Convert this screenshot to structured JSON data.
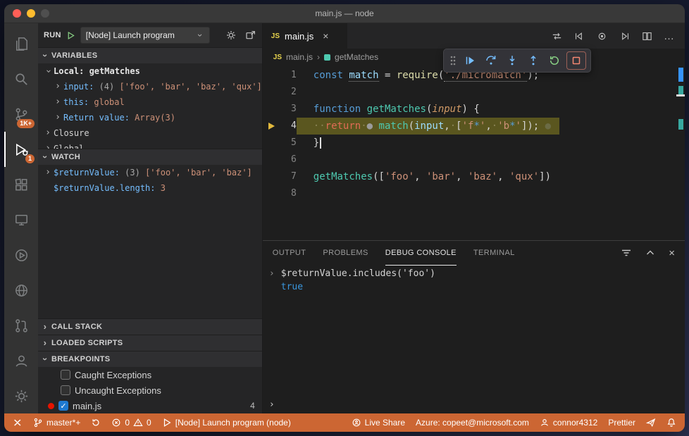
{
  "window": {
    "title": "main.js — node"
  },
  "icons": {
    "chevron": "›",
    "close": "×",
    "js": "JS",
    "sep": "›",
    "more": "…",
    "prompt": "›",
    "check": "✓"
  },
  "colors": {
    "status_bar": "#CC6633",
    "badge": "#CC6633",
    "accent": "#75BEFF",
    "debug_green": "#89D185",
    "debug_red": "#F48771",
    "current_line": "#5A561F",
    "breakpoint_red": "#E51400",
    "keyword": "#569CD6",
    "function": "#DCDCAA",
    "type_green": "#4EC9B0",
    "variable": "#9CDCFE",
    "string": "#CE9178",
    "control": "#E06C55",
    "param": "#D19A66",
    "console_blue": "#3A96DD",
    "checkbox_blue": "#1F7AD1",
    "debug_arrow": "#E2B93D",
    "traffic_red": "#FF5F57",
    "traffic_yellow": "#FEBC2E",
    "traffic_gray": "#4F4F4F"
  },
  "activity_bar": {
    "scm_badge": "1K+",
    "debug_badge": "1"
  },
  "sidebar": {
    "run": {
      "label": "RUN",
      "config": "[Node] Launch program"
    },
    "variables": {
      "title": "VARIABLES",
      "rows": [
        {
          "indent": 1,
          "chev": "open",
          "tokens": [
            {
              "t": "Local: getMatches",
              "c": "scope"
            }
          ]
        },
        {
          "indent": 2,
          "chev": "closed",
          "tokens": [
            {
              "t": "input: ",
              "c": "vname"
            },
            {
              "t": "(4) ",
              "c": "vmeta"
            },
            {
              "t": "['foo', 'bar', 'baz', 'qux']",
              "c": "vstr"
            }
          ]
        },
        {
          "indent": 2,
          "chev": "closed",
          "tokens": [
            {
              "t": "this: ",
              "c": "vname"
            },
            {
              "t": "global",
              "c": "vval"
            }
          ]
        },
        {
          "indent": 2,
          "chev": "closed",
          "tokens": [
            {
              "t": "Return value: ",
              "c": "vname"
            },
            {
              "t": "Array(3)",
              "c": "vval"
            }
          ]
        },
        {
          "indent": 1,
          "chev": "closed",
          "tokens": [
            {
              "t": "Closure",
              "c": "vplain"
            }
          ]
        },
        {
          "indent": 1,
          "chev": "closed",
          "tokens": [
            {
              "t": "Global",
              "c": "vplain"
            }
          ]
        }
      ]
    },
    "watch": {
      "title": "WATCH",
      "rows": [
        {
          "indent": 1,
          "chev": "closed",
          "tokens": [
            {
              "t": "$returnValue: ",
              "c": "vname"
            },
            {
              "t": "(3) ",
              "c": "vmeta"
            },
            {
              "t": "['foo', 'bar', 'baz']",
              "c": "vstr"
            }
          ]
        },
        {
          "indent": 1,
          "chev": "none",
          "tokens": [
            {
              "t": "$returnValue.length: ",
              "c": "vname"
            },
            {
              "t": "3",
              "c": "vstr"
            }
          ]
        }
      ]
    },
    "call_stack": {
      "title": "CALL STACK"
    },
    "loaded_scripts": {
      "title": "LOADED SCRIPTS"
    },
    "breakpoints": {
      "title": "BREAKPOINTS",
      "items": [
        {
          "checked": false,
          "dot": false,
          "label": "Caught Exceptions"
        },
        {
          "checked": false,
          "dot": false,
          "label": "Uncaught Exceptions"
        },
        {
          "checked": true,
          "dot": true,
          "label": "main.js",
          "right": "4"
        }
      ]
    }
  },
  "editor": {
    "tab": {
      "label": "main.js"
    },
    "breadcrumb": {
      "file": "main.js",
      "symbol": "getMatches"
    },
    "lines": [
      {
        "n": "1",
        "tokens": [
          {
            "t": "const",
            "c": "kw"
          },
          {
            "t": " "
          },
          {
            "t": "match",
            "c": "var u"
          },
          {
            "t": " = ",
            "c": "pun"
          },
          {
            "t": "require",
            "c": "fn"
          },
          {
            "t": "(",
            "c": "pun"
          },
          {
            "t": "'./micromatch'",
            "c": "str u"
          },
          {
            "t": ");",
            "c": "pun"
          }
        ]
      },
      {
        "n": "2",
        "tokens": []
      },
      {
        "n": "3",
        "tokens": [
          {
            "t": "function",
            "c": "kw"
          },
          {
            "t": " "
          },
          {
            "t": "getMatches",
            "c": "fng"
          },
          {
            "t": "(",
            "c": "pun"
          },
          {
            "t": "input",
            "c": "param"
          },
          {
            "t": ") {",
            "c": "pun"
          }
        ]
      },
      {
        "n": "4",
        "current": true,
        "tokens": [
          {
            "t": "··",
            "c": "ws"
          },
          {
            "t": "return",
            "c": "ctrl"
          },
          {
            "t": "·",
            "c": "ws"
          },
          {
            "t": "●",
            "c": "dot"
          },
          {
            "t": " "
          },
          {
            "t": "match",
            "c": "fng"
          },
          {
            "t": "(",
            "c": "pun"
          },
          {
            "t": "input",
            "c": "var"
          },
          {
            "t": ",",
            "c": "pun"
          },
          {
            "t": "·",
            "c": "ws"
          },
          {
            "t": "[",
            "c": "pun"
          },
          {
            "t": "'f",
            "c": "str"
          },
          {
            "t": "*",
            "c": "kw"
          },
          {
            "t": "'",
            "c": "str"
          },
          {
            "t": ",",
            "c": "pun"
          },
          {
            "t": "·",
            "c": "ws"
          },
          {
            "t": "'b",
            "c": "str"
          },
          {
            "t": "*",
            "c": "kw"
          },
          {
            "t": "'",
            "c": "str"
          },
          {
            "t": "]);",
            "c": "pun"
          },
          {
            "t": " ●",
            "c": "dot2"
          }
        ]
      },
      {
        "n": "5",
        "tokens": [
          {
            "t": "}",
            "c": "pun"
          },
          {
            "t": "",
            "c": "cursor"
          }
        ]
      },
      {
        "n": "6",
        "tokens": []
      },
      {
        "n": "7",
        "tokens": [
          {
            "t": "getMatches",
            "c": "fng"
          },
          {
            "t": "([",
            "c": "pun"
          },
          {
            "t": "'foo'",
            "c": "str"
          },
          {
            "t": ", ",
            "c": "pun"
          },
          {
            "t": "'bar'",
            "c": "str"
          },
          {
            "t": ", ",
            "c": "pun"
          },
          {
            "t": "'baz'",
            "c": "str"
          },
          {
            "t": ", ",
            "c": "pun"
          },
          {
            "t": "'qux'",
            "c": "str"
          },
          {
            "t": "])",
            "c": "pun"
          }
        ]
      },
      {
        "n": "8",
        "tokens": []
      }
    ]
  },
  "panel": {
    "tabs": [
      {
        "label": "OUTPUT",
        "active": false
      },
      {
        "label": "PROBLEMS",
        "active": false
      },
      {
        "label": "DEBUG CONSOLE",
        "active": true
      },
      {
        "label": "TERMINAL",
        "active": false
      }
    ],
    "console": [
      {
        "gutter": "›",
        "tokens": [
          {
            "t": "$returnValue.includes('foo')",
            "c": "plain"
          }
        ]
      },
      {
        "gutter": "",
        "tokens": [
          {
            "t": "true",
            "c": "cblue"
          }
        ]
      }
    ]
  },
  "status_bar": {
    "branch": "master*+",
    "errors": "0",
    "warnings": "0",
    "debug_config": "[Node] Launch program (node)",
    "live_share": "Live Share",
    "azure": "Azure: copeet@microsoft.com",
    "account": "connor4312",
    "formatter": "Prettier"
  }
}
